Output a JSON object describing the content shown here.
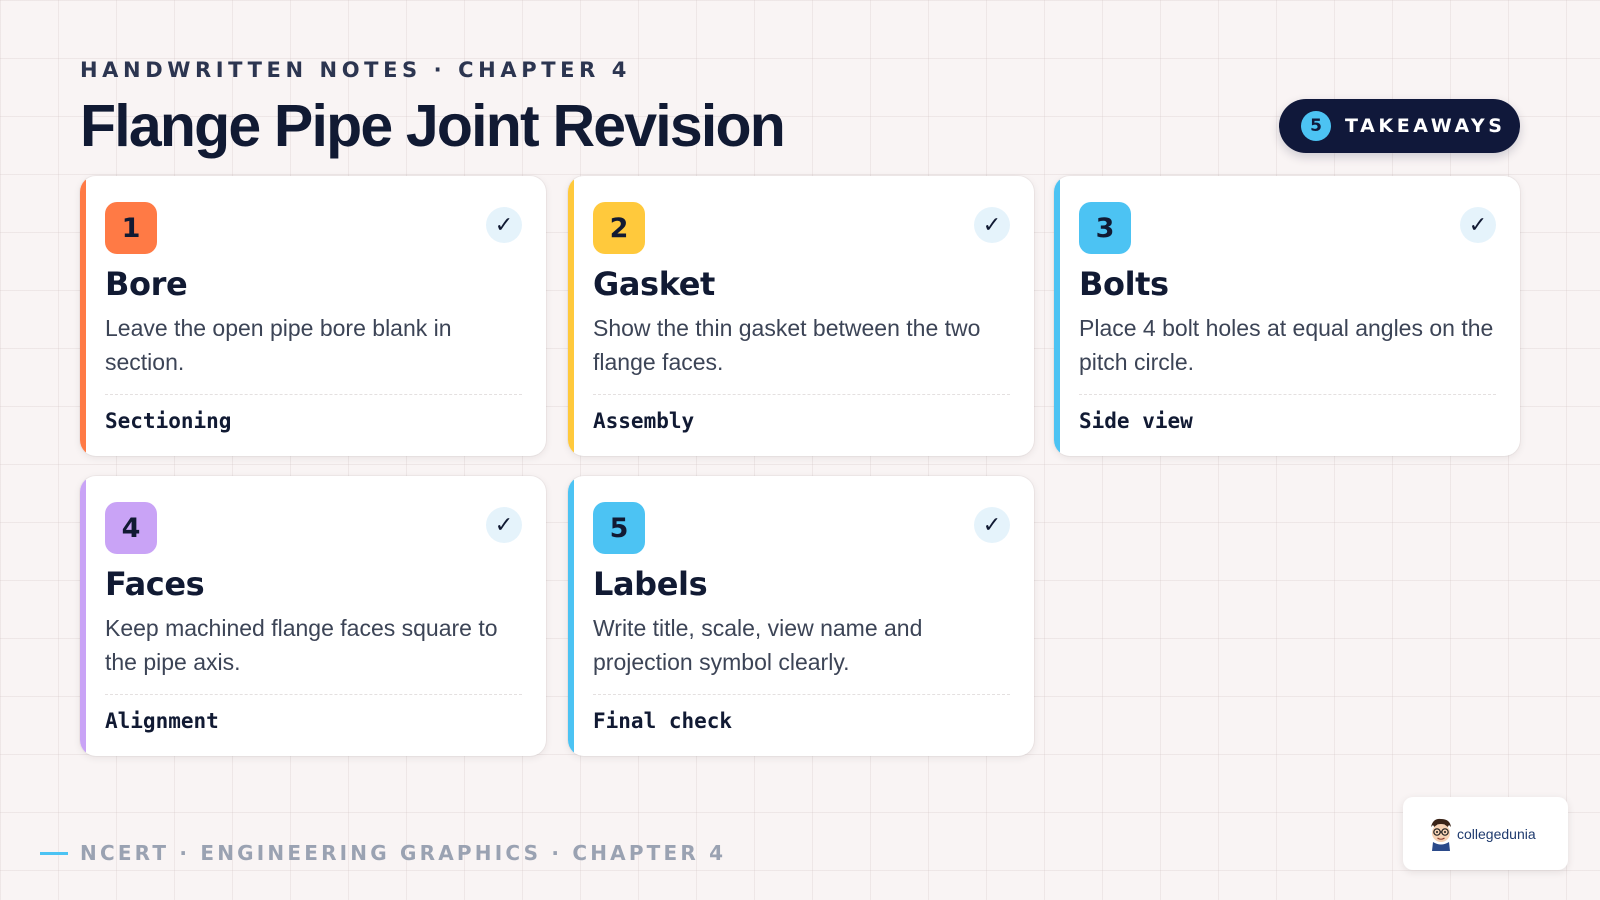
{
  "header": {
    "eyebrow": "HANDWRITTEN NOTES · CHAPTER 4",
    "title": "Flange Pipe Joint Revision"
  },
  "badge": {
    "count": "5",
    "label": "TAKEAWAYS"
  },
  "check_glyph": "✓",
  "cards": [
    {
      "number": "1",
      "title": "Bore",
      "description": "Leave the open pipe bore blank in section.",
      "tag": "Sectioning",
      "accent": "#ff7a45",
      "number_bg": "#ff7a45"
    },
    {
      "number": "2",
      "title": "Gasket",
      "description": "Show the thin gasket between the two flange faces.",
      "tag": "Assembly",
      "accent": "#ffc93c",
      "number_bg": "#ffc93c"
    },
    {
      "number": "3",
      "title": "Bolts",
      "description": "Place 4 bolt holes at equal angles on the pitch circle.",
      "tag": "Side view",
      "accent": "#4cc3f3",
      "number_bg": "#4cc3f3"
    },
    {
      "number": "4",
      "title": "Faces",
      "description": "Keep machined flange faces square to the pipe axis.",
      "tag": "Alignment",
      "accent": "#c9a3f6",
      "number_bg": "#c9a3f6"
    },
    {
      "number": "5",
      "title": "Labels",
      "description": "Write title, scale, view name and projection symbol clearly.",
      "tag": "Final check",
      "accent": "#4cc3f3",
      "number_bg": "#4cc3f3"
    }
  ],
  "footer": {
    "text": "NCERT · ENGINEERING GRAPHICS · CHAPTER 4"
  },
  "logo": {
    "text": "collegedunia",
    "icon": "student-mascot-icon"
  }
}
